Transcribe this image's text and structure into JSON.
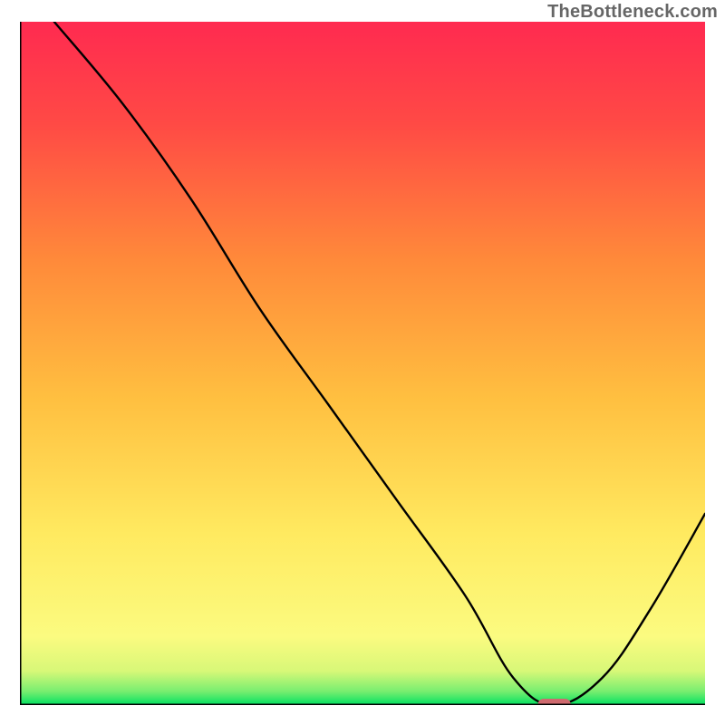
{
  "watermark": "TheBottleneck.com",
  "chart_data": {
    "type": "line",
    "title": "",
    "xlabel": "",
    "ylabel": "",
    "xlim": [
      0,
      100
    ],
    "ylim": [
      0,
      100
    ],
    "grid": false,
    "legend": false,
    "curve": {
      "name": "bottleneck-curve",
      "x": [
        5,
        15,
        25,
        35,
        45,
        55,
        65,
        72,
        78,
        85,
        92,
        100
      ],
      "y": [
        100,
        88,
        74,
        58,
        44,
        30,
        16,
        4,
        0,
        4,
        14,
        28
      ]
    },
    "marker": {
      "name": "optimal-point",
      "x": 78,
      "y": 0,
      "color": "#cf6a6f"
    },
    "gradient_stops": [
      {
        "offset": 0.0,
        "color": "#00e060"
      },
      {
        "offset": 0.02,
        "color": "#78ee70"
      },
      {
        "offset": 0.05,
        "color": "#d8f878"
      },
      {
        "offset": 0.1,
        "color": "#fbfb80"
      },
      {
        "offset": 0.25,
        "color": "#ffea60"
      },
      {
        "offset": 0.45,
        "color": "#ffbf40"
      },
      {
        "offset": 0.65,
        "color": "#ff8a3a"
      },
      {
        "offset": 0.85,
        "color": "#ff4a45"
      },
      {
        "offset": 1.0,
        "color": "#ff2a50"
      }
    ],
    "axis": {
      "color": "#000000",
      "width": 3
    },
    "curve_style": {
      "color": "#000000",
      "width": 2.4
    },
    "marker_style": {
      "rx": 18,
      "ry": 7,
      "corner": 6
    }
  }
}
